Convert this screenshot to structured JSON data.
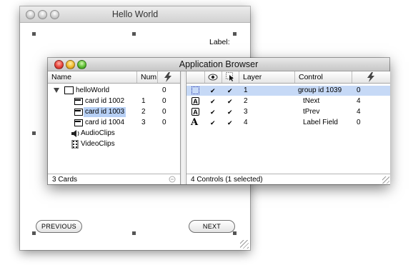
{
  "hello_world_window": {
    "title": "Hello World",
    "label_text": "Label:",
    "previous_button": "PREVIOUS",
    "next_button": "NEXT"
  },
  "app_browser": {
    "title": "Application Browser",
    "left_pane": {
      "columns": {
        "name": "Name",
        "num": "Num",
        "count_icon": "lightning-icon"
      },
      "rows": [
        {
          "name": "helloWorld",
          "num": "",
          "count": "0",
          "icon": "stack-icon"
        },
        {
          "name": "card id 1002",
          "num": "1",
          "count": "0",
          "icon": "card-icon"
        },
        {
          "name": "card id 1003",
          "num": "2",
          "count": "0",
          "icon": "card-icon",
          "selected": true
        },
        {
          "name": "card id 1004",
          "num": "3",
          "count": "0",
          "icon": "card-icon"
        },
        {
          "name": "AudioClips",
          "num": "",
          "count": "",
          "icon": "audio-icon"
        },
        {
          "name": "VideoClips",
          "num": "",
          "count": "",
          "icon": "video-icon"
        }
      ],
      "status": "3 Cards"
    },
    "right_pane": {
      "columns": {
        "visible_icon": "eye-icon",
        "select_icon": "cursor-icon",
        "layer": "Layer",
        "control": "Control",
        "count_icon": "lightning-icon"
      },
      "rows": [
        {
          "type_icon": "group-icon",
          "visible": "✔",
          "selectable": "✔",
          "layer": "1",
          "control": "group id 1039",
          "count": "0",
          "selected": true
        },
        {
          "type_icon": "button-icon",
          "visible": "✔",
          "selectable": "✔",
          "layer": "2",
          "control": "tNext",
          "count": "4"
        },
        {
          "type_icon": "button-icon",
          "visible": "✔",
          "selectable": "✔",
          "layer": "3",
          "control": "tPrev",
          "count": "4"
        },
        {
          "type_icon": "field-icon",
          "visible": "✔",
          "selectable": "✔",
          "layer": "4",
          "control": "Label Field",
          "count": "0"
        }
      ],
      "status": "4 Controls (1 selected)"
    },
    "colors": {
      "selection": "#c6d9f6"
    }
  }
}
